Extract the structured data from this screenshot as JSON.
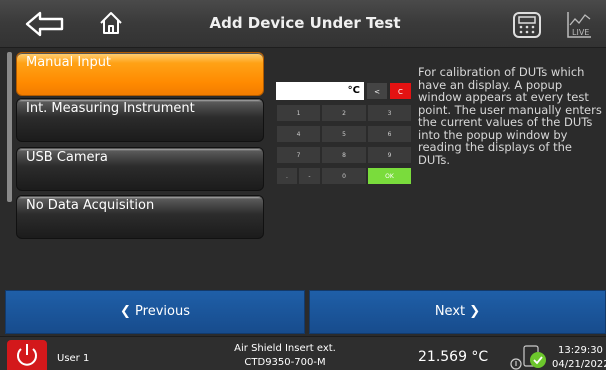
{
  "header": {
    "title": "Add Device Under Test",
    "live_label": "LIVE"
  },
  "list": {
    "items": [
      {
        "label": "Manual Input",
        "active": true
      },
      {
        "label": "Int. Measuring Instrument",
        "active": false
      },
      {
        "label": "USB Camera",
        "active": false
      },
      {
        "label": "No Data Acquisition",
        "active": false
      }
    ]
  },
  "keypad": {
    "unit": "°C",
    "back": "<",
    "clear": "C",
    "keys": [
      "1",
      "2",
      "3",
      "4",
      "5",
      "6",
      "7",
      "8",
      "9",
      ".",
      "-",
      "0"
    ],
    "ok": "OK"
  },
  "description": "For calibration of DUTs which have an display. A popup window appears at every test point. The user manually enters the current values of the DUTs into the popup window by reading the displays of the DUTs.",
  "nav": {
    "previous": "Previous",
    "next": "Next"
  },
  "status": {
    "user": "User 1",
    "probe_line1": "Air Shield Insert ext.",
    "probe_line2": "CTD9350-700-M",
    "temperature": "21.569 °C",
    "time": "13:29:30",
    "date": "04/21/2022"
  },
  "colors": {
    "accent_orange": "#ff8a00",
    "nav_blue": "#1f5fa8",
    "power_red": "#d3181b",
    "ok_green": "#7adc3c"
  }
}
